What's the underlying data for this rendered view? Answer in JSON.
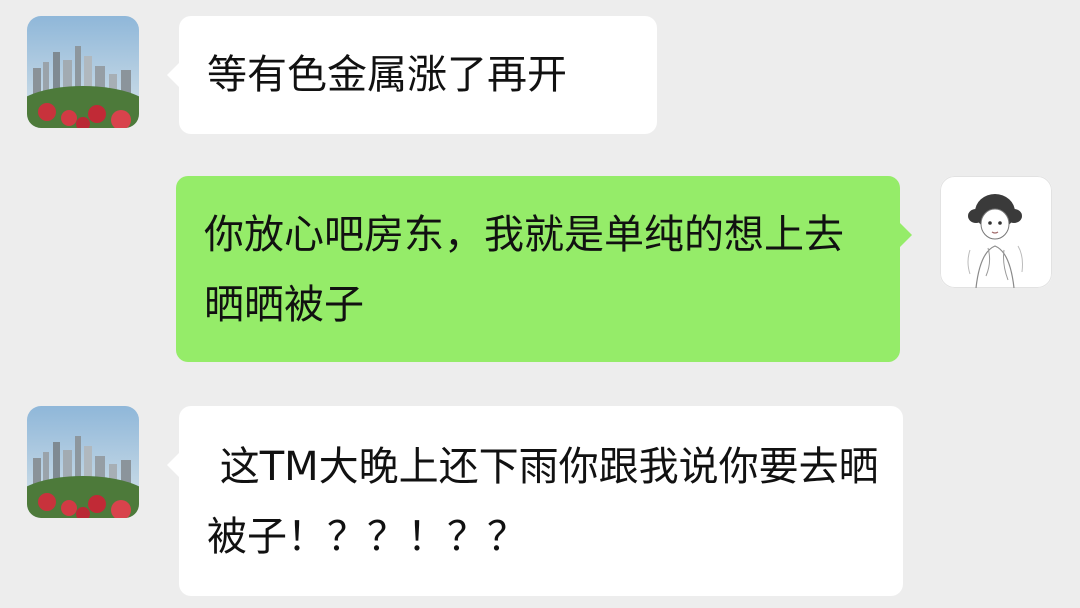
{
  "conversation": {
    "messages": [
      {
        "direction": "incoming",
        "text": "等有色金属涨了再开"
      },
      {
        "direction": "outgoing",
        "text": "你放心吧房东，我就是单纯的想上去晒晒被子"
      },
      {
        "direction": "incoming",
        "text": " 这TM大晚上还下雨你跟我说你要去晒被子！？？！？？"
      }
    ]
  },
  "theme": {
    "background": "#ededed",
    "incoming_bubble": "#ffffff",
    "outgoing_bubble": "#95ec69",
    "text_color": "#111111"
  },
  "avatars": {
    "landlord": "city-skyline-avatar",
    "tenant": "sketch-girl-avatar"
  }
}
